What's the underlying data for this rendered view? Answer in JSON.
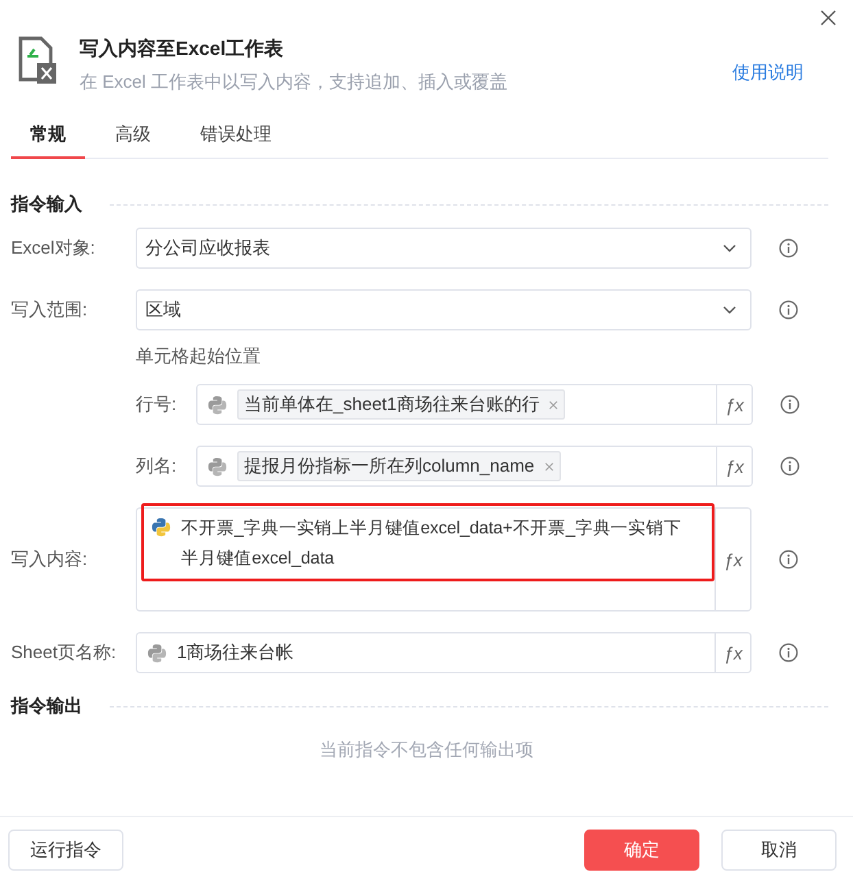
{
  "header": {
    "title": "写入内容至Excel工作表",
    "subtitle": "在 Excel 工作表中以写入内容，支持追加、插入或覆盖",
    "help_link": "使用说明"
  },
  "tabs": [
    {
      "label": "常规",
      "selected": true
    },
    {
      "label": "高级",
      "selected": false
    },
    {
      "label": "错误处理",
      "selected": false
    }
  ],
  "input_section": {
    "title": "指令输入",
    "fields": [
      {
        "kind": "select",
        "label": "Excel对象:",
        "value": "分公司应收报表"
      },
      {
        "kind": "select",
        "label": "写入范围:",
        "value": "区域"
      },
      {
        "kind": "note",
        "text": "单元格起始位置"
      },
      {
        "kind": "chip",
        "label": "行号:",
        "value": "当前单体在_sheet1商场往来台账的行",
        "indented": true,
        "fx": "ƒx"
      },
      {
        "kind": "chip",
        "label": "列名:",
        "value": "提报月份指标一所在列column_name",
        "indented": true,
        "fx": "ƒx"
      },
      {
        "kind": "text",
        "label": "写入内容:",
        "value": "不开票_字典一实销上半月键值excel_data+不开票_字典一实销下半月键值excel_data",
        "annotated": true,
        "fx": "ƒx"
      },
      {
        "kind": "plain",
        "label": "Sheet页名称:",
        "value": "1商场往来台帐",
        "fx": "ƒx"
      }
    ]
  },
  "output_section": {
    "title": "指令输出",
    "empty_text": "当前指令不包含任何输出项"
  },
  "footer": {
    "run_button": "运行指令",
    "ok_button": "确定",
    "cancel_button": "取消"
  }
}
